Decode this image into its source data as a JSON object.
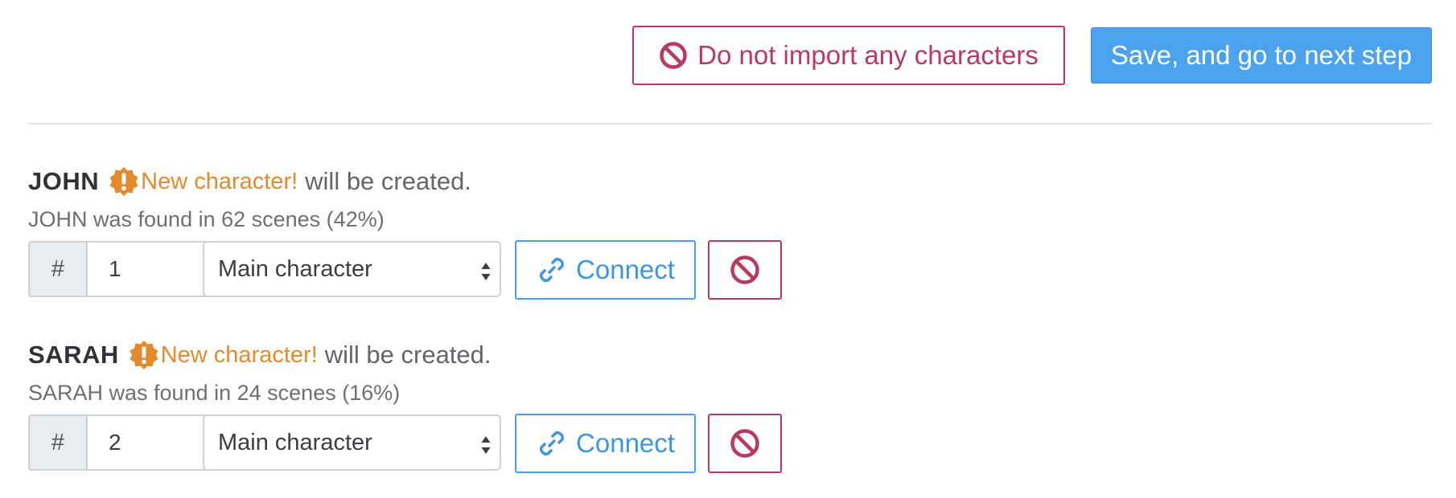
{
  "toolbar": {
    "skip_label": "Do not import any characters",
    "save_label": "Save, and go to next step"
  },
  "characters": [
    {
      "name": "JOHN",
      "status": "New character!",
      "status_suffix": "will be created.",
      "found": "JOHN was found in 62 scenes (42%)",
      "hash": "#",
      "number": "1",
      "role": "Main character",
      "connect_label": "Connect"
    },
    {
      "name": "SARAH",
      "status": "New character!",
      "status_suffix": "will be created.",
      "found": "SARAH was found in 24 scenes (16%)",
      "hash": "#",
      "number": "2",
      "role": "Main character",
      "connect_label": "Connect"
    }
  ],
  "icons": {
    "skip": "ban-icon",
    "warning": "exclamation-badge-icon",
    "connect": "link-icon",
    "remove": "ban-icon"
  },
  "colors": {
    "danger": "#b9395f",
    "primary": "#4ca2ec",
    "warning": "#e38a2c",
    "link": "#3f95e0"
  }
}
